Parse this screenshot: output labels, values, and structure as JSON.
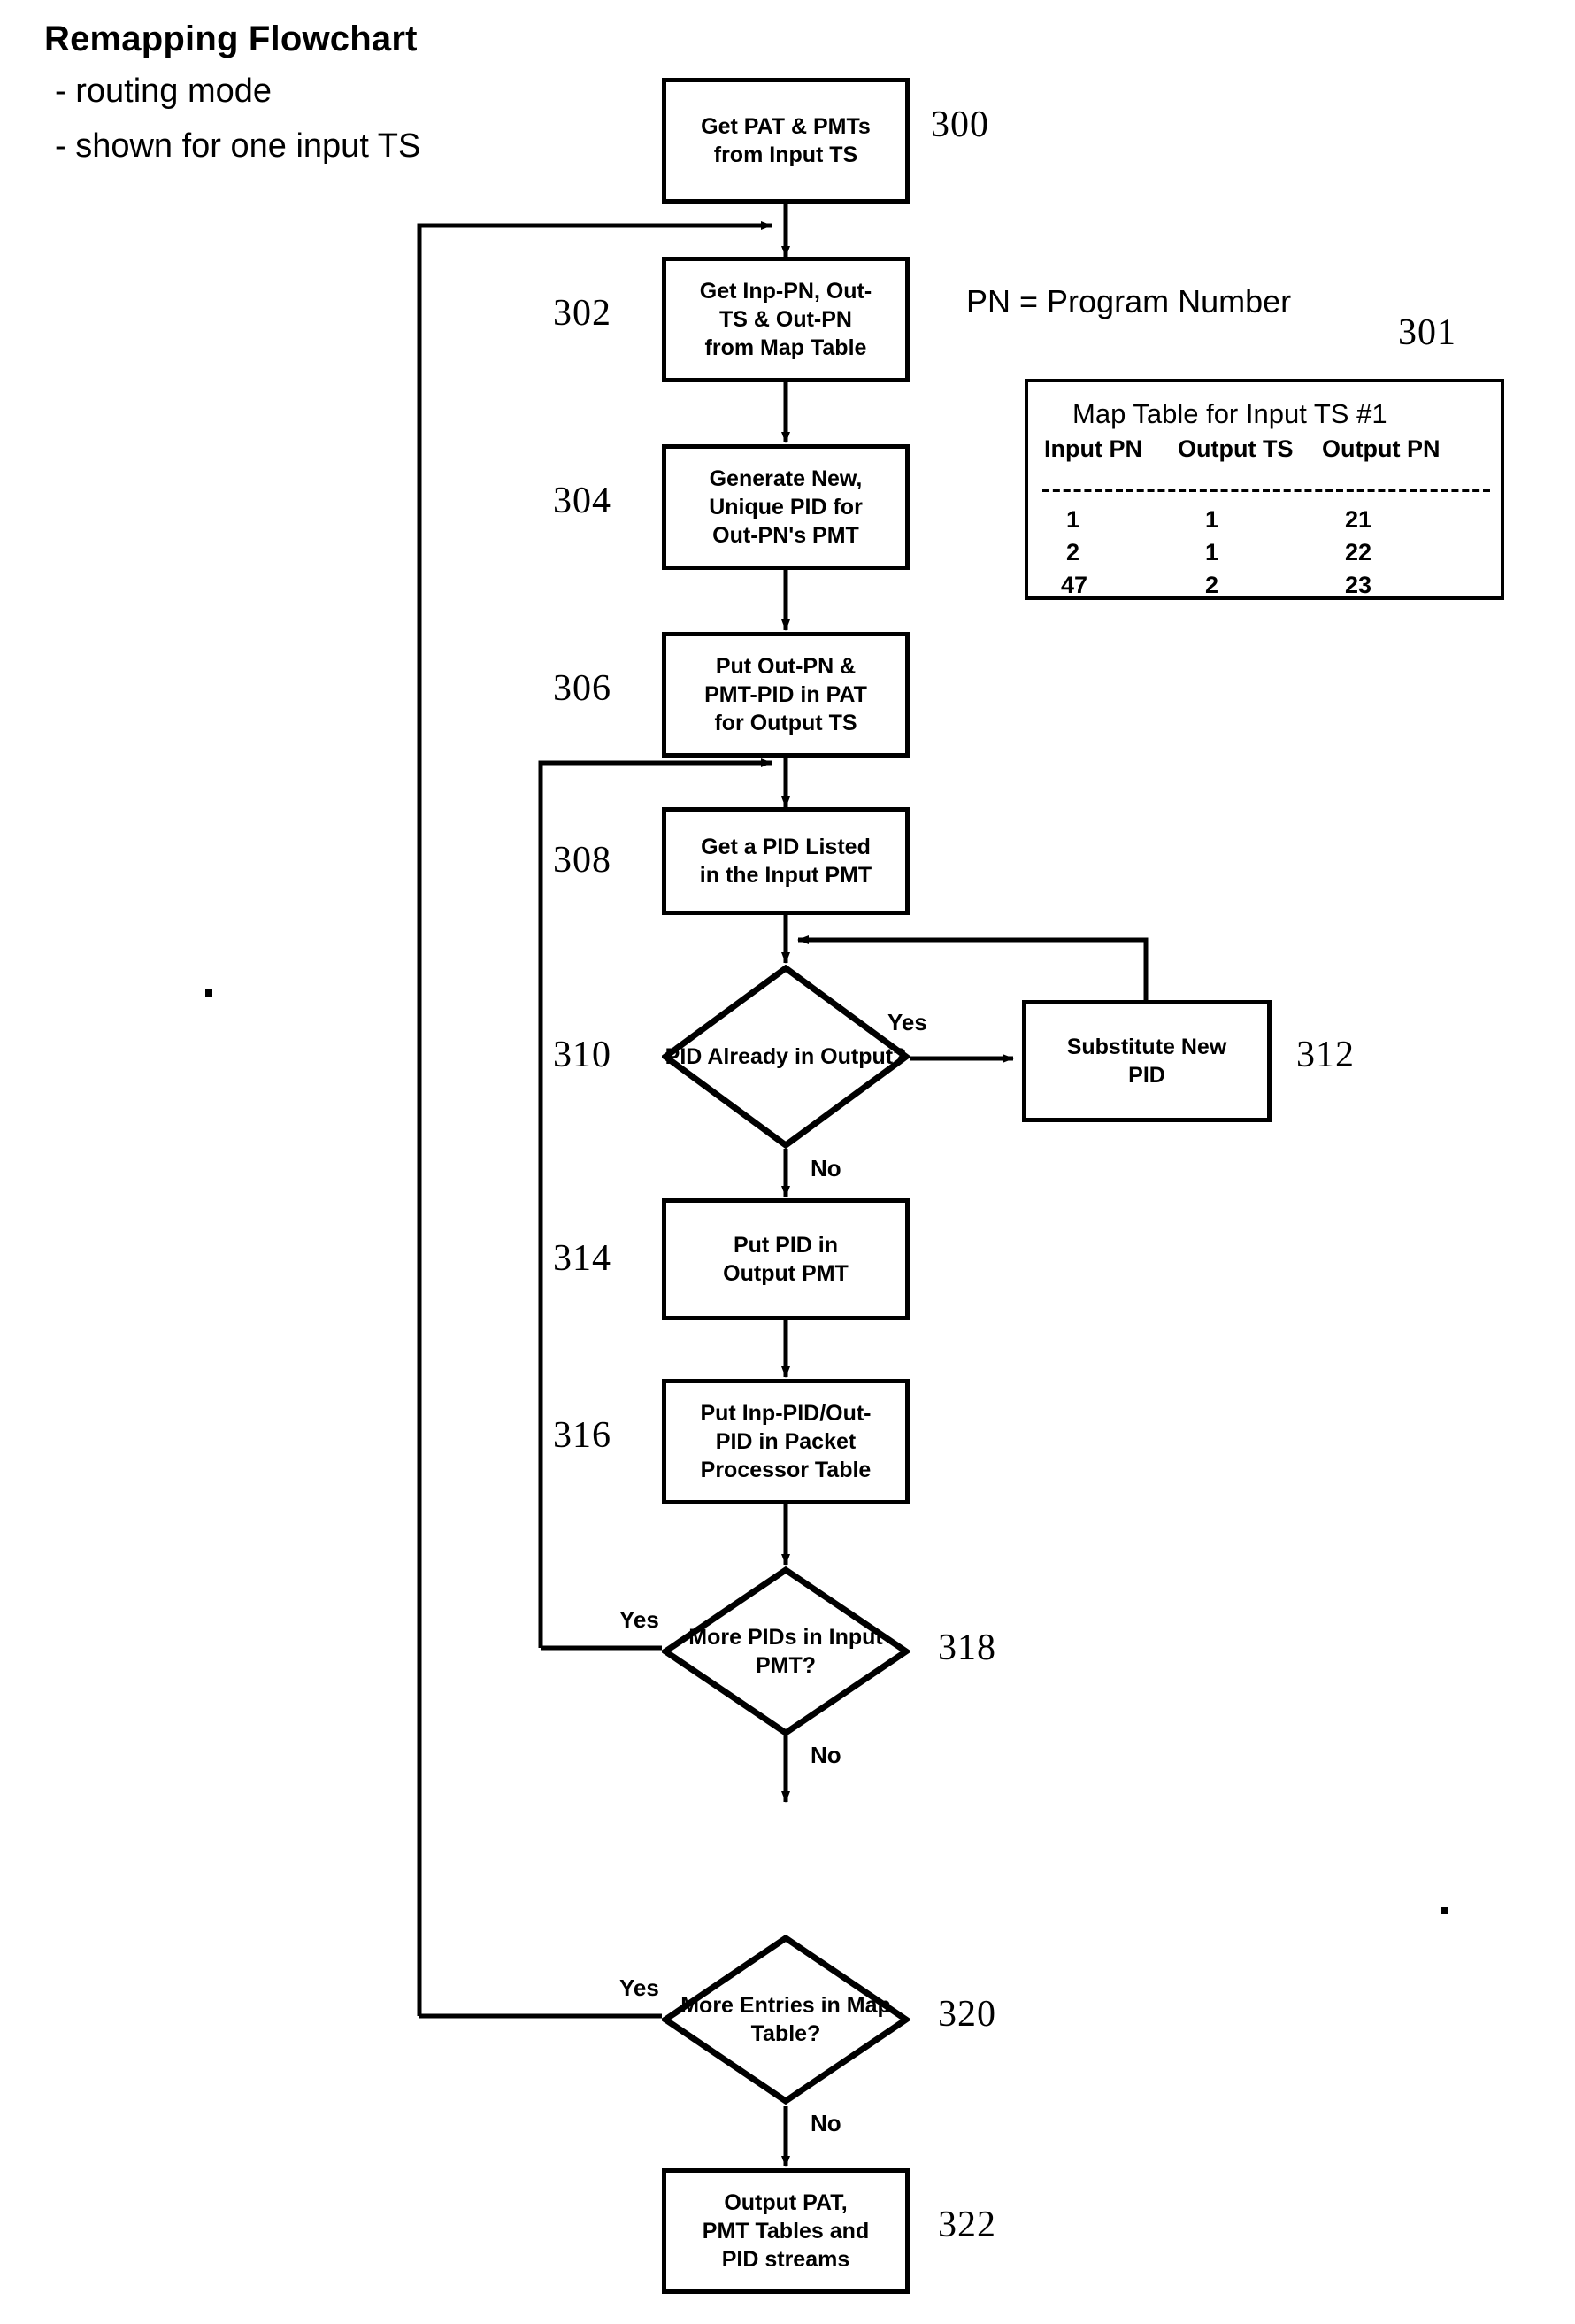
{
  "header": {
    "title": "Remapping Flowchart",
    "bullets": [
      "- routing mode",
      "- shown for one input TS"
    ]
  },
  "legend": {
    "text": "PN = Program Number"
  },
  "map_table": {
    "ref": "301",
    "title": "Map Table for Input TS #1",
    "columns": [
      "Input PN",
      "Output TS",
      "Output PN"
    ],
    "rows": [
      [
        "1",
        "1",
        "21"
      ],
      [
        "2",
        "1",
        "22"
      ],
      [
        "47",
        "2",
        "23"
      ]
    ]
  },
  "nodes": [
    {
      "id": "n300",
      "ref": "300",
      "shape": "process",
      "lines": [
        "Get PAT & PMTs",
        "from Input TS"
      ]
    },
    {
      "id": "n302",
      "ref": "302",
      "shape": "process",
      "lines": [
        "Get Inp-PN, Out-",
        "TS & Out-PN",
        "from Map Table"
      ]
    },
    {
      "id": "n304",
      "ref": "304",
      "shape": "process",
      "lines": [
        "Generate New,",
        "Unique PID for",
        "Out-PN's PMT"
      ]
    },
    {
      "id": "n306",
      "ref": "306",
      "shape": "process",
      "lines": [
        "Put Out-PN &",
        "PMT-PID in PAT",
        "for Output TS"
      ]
    },
    {
      "id": "n308",
      "ref": "308",
      "shape": "process",
      "lines": [
        "Get a PID Listed",
        "in the Input PMT"
      ]
    },
    {
      "id": "n310",
      "ref": "310",
      "shape": "decision",
      "lines": [
        "PID Already",
        "in Output?"
      ]
    },
    {
      "id": "n312",
      "ref": "312",
      "shape": "process",
      "lines": [
        "Substitute New",
        "PID"
      ]
    },
    {
      "id": "n314",
      "ref": "314",
      "shape": "process",
      "lines": [
        "Put PID in",
        "Output PMT"
      ]
    },
    {
      "id": "n316",
      "ref": "316",
      "shape": "process",
      "lines": [
        "Put Inp-PID/Out-",
        "PID in Packet",
        "Processor Table"
      ]
    },
    {
      "id": "n318",
      "ref": "318",
      "shape": "decision",
      "lines": [
        "More PIDs in",
        "Input PMT?"
      ]
    },
    {
      "id": "n320",
      "ref": "320",
      "shape": "decision",
      "lines": [
        "More Entries",
        "in Map Table?"
      ]
    },
    {
      "id": "n322",
      "ref": "322",
      "shape": "process",
      "lines": [
        "Output PAT,",
        "PMT Tables and",
        "PID streams"
      ]
    }
  ],
  "edge_labels": {
    "e310_yes": "Yes",
    "e310_no": "No",
    "e318_yes": "Yes",
    "e318_no": "No",
    "e320_yes": "Yes",
    "e320_no": "No"
  },
  "colors": {
    "ink": "#000000",
    "paper": "#ffffff"
  }
}
